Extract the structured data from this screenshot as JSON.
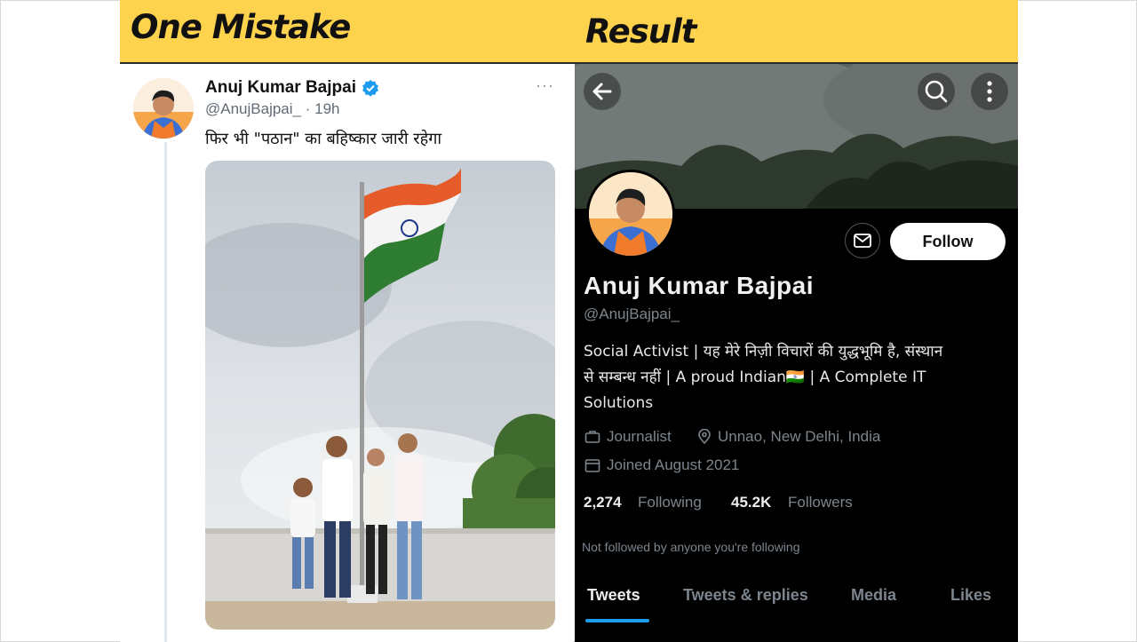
{
  "labels": {
    "left": "One Mistake",
    "right": "Result"
  },
  "tweet": {
    "name": "Anuj Kumar Bajpai",
    "handle": "@AnujBajpai_",
    "time": "· 19h",
    "more_icon": "more-dots-icon",
    "text": "फिर भी \"पठान\" का बहिष्कार जारी रहेगा"
  },
  "profile": {
    "follow_label": "Follow",
    "name": "Anuj Kumar Bajpai",
    "handle": "@AnujBajpai_",
    "bio_line1": "Social Activist | यह मेरे निज़ी विचारों की युद्धभूमि है, संस्थान",
    "bio_line2": "से सम्बन्ध नहीं | A proud Indian🇮🇳 | A Complete IT",
    "bio_line3": "Solutions",
    "profession": "Journalist",
    "location": "Unnao, New Delhi, India",
    "joined": "Joined August 2021",
    "following_count": "2,274",
    "following_label": "Following",
    "followers_count": "45.2K",
    "followers_label": "Followers",
    "not_followed": "Not followed by anyone you're following",
    "tabs": [
      "Tweets",
      "Tweets & replies",
      "Media",
      "Likes"
    ]
  },
  "colors": {
    "band": "#fdd34e",
    "twitter_blue": "#1d9bf0"
  }
}
